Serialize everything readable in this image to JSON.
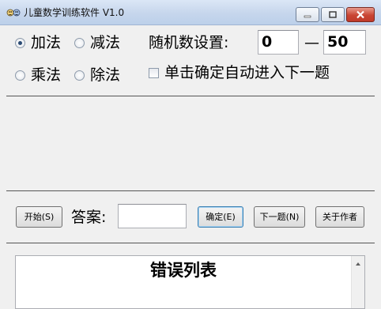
{
  "window": {
    "title": "儿童数学训练软件 V1.0",
    "app_icon": "cartoon-faces-icon",
    "controls": [
      "minimize-icon",
      "maximize-icon",
      "close-icon"
    ]
  },
  "operations": {
    "add": "加法",
    "subtract": "减法",
    "multiply": "乘法",
    "divide": "除法",
    "selected": "加法"
  },
  "random_range": {
    "label": "随机数设置:",
    "min": "0",
    "separator": "—",
    "max": "50"
  },
  "auto_next": {
    "label": "单击确定自动进入下一题",
    "checked": false
  },
  "question_area": {
    "text": ""
  },
  "answer": {
    "label": "答案:",
    "value": ""
  },
  "buttons": {
    "start": "开始(S)",
    "confirm": "确定(E)",
    "next": "下一题(N)",
    "about": "关于作者"
  },
  "error_list": {
    "title": "错误列表",
    "items": []
  },
  "colors": {
    "title_bar": "#c6d6ec",
    "window_bg": "#f0f0f0",
    "close_button": "#c94533",
    "default_button_border": "#3c7fb1"
  }
}
